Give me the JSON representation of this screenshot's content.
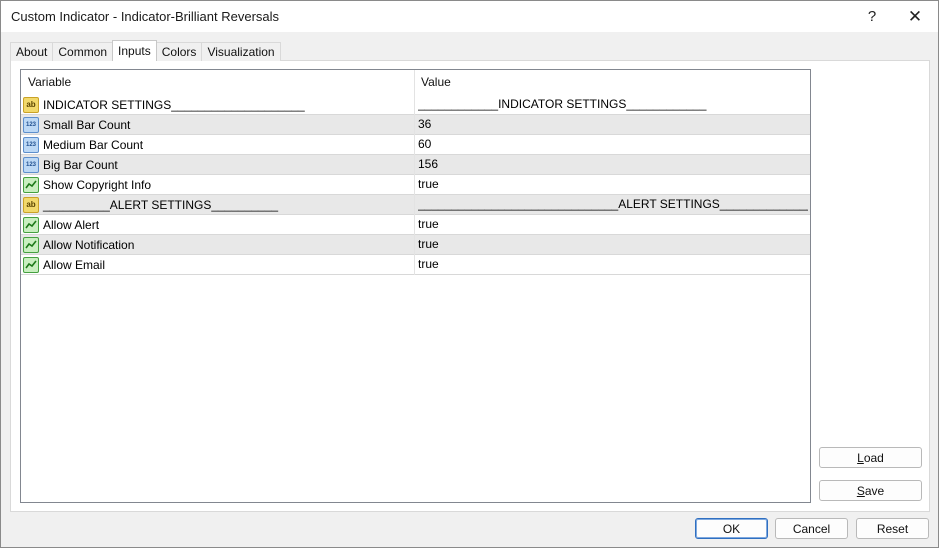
{
  "window": {
    "title": "Custom Indicator - Indicator-Brilliant Reversals",
    "help_glyph": "?",
    "close_glyph": "✕"
  },
  "tabs": [
    {
      "label": "About"
    },
    {
      "label": "Common"
    },
    {
      "label": "Inputs",
      "active": true
    },
    {
      "label": "Colors"
    },
    {
      "label": "Visualization"
    }
  ],
  "grid": {
    "headers": {
      "variable": "Variable",
      "value": "Value"
    },
    "rows": [
      {
        "icon": "string-icon",
        "icon_text": "ab",
        "variable": "INDICATOR SETTINGS____________________",
        "value": "____________INDICATOR SETTINGS____________"
      },
      {
        "icon": "number-icon",
        "icon_text": "123",
        "variable": "Small Bar Count",
        "value": "36"
      },
      {
        "icon": "number-icon",
        "icon_text": "123",
        "variable": "Medium Bar Count",
        "value": "60"
      },
      {
        "icon": "number-icon",
        "icon_text": "123",
        "variable": "Big Bar Count",
        "value": "156"
      },
      {
        "icon": "bool-icon",
        "icon_text": "",
        "variable": "Show Copyright Info",
        "value": "true"
      },
      {
        "icon": "string-icon",
        "icon_text": "ab",
        "variable": "__________ALERT SETTINGS__________",
        "value": "______________________________ALERT SETTINGS______________..."
      },
      {
        "icon": "bool-icon",
        "icon_text": "",
        "variable": "Allow Alert",
        "value": "true"
      },
      {
        "icon": "bool-icon",
        "icon_text": "",
        "variable": "Allow Notification",
        "value": "true"
      },
      {
        "icon": "bool-icon",
        "icon_text": "",
        "variable": "Allow Email",
        "value": "true"
      }
    ]
  },
  "buttons": {
    "load": {
      "accel": "L",
      "rest": "oad"
    },
    "save": {
      "accel": "S",
      "rest": "ave"
    },
    "ok": "OK",
    "cancel": "Cancel",
    "reset": "Reset"
  },
  "colors": {
    "alt_row": "#e8e8e8",
    "ok_border": "#2f6fc1"
  }
}
